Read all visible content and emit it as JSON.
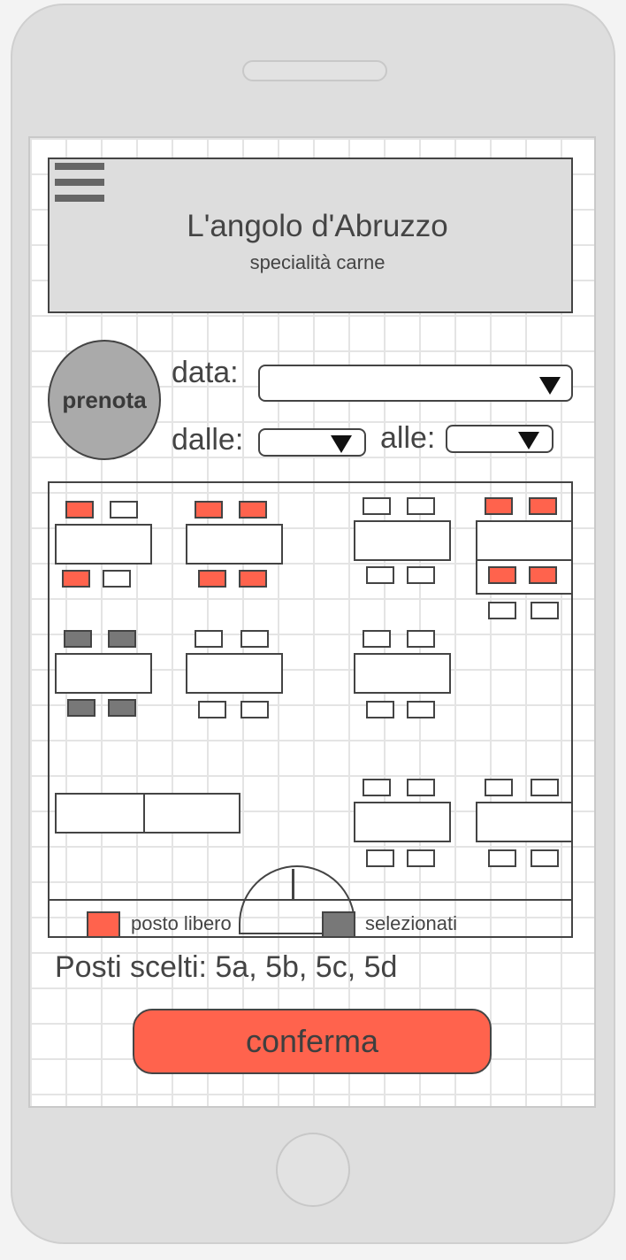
{
  "header": {
    "title": "L'angolo d'Abruzzo",
    "subtitle": "specialità carne",
    "menu_icon": "hamburger-menu-icon"
  },
  "booking": {
    "prenota_label": "prenota",
    "date_label": "data:",
    "date_value": "",
    "from_label": "dalle:",
    "from_value": "",
    "to_label": "alle:",
    "to_value": "",
    "dropdown_icon": "triangle-down-icon"
  },
  "floor_plan": {
    "seat_states": [
      "empty",
      "free",
      "selected"
    ],
    "colors": {
      "free": "#ff634d",
      "selected": "#787878",
      "empty": "#ffffff"
    }
  },
  "legend": {
    "free_label": "posto libero",
    "selected_label": "selezionati"
  },
  "selection": {
    "summary": "Posti scelti: 5a, 5b, 5c, 5d"
  },
  "confirm_label": "conferma"
}
